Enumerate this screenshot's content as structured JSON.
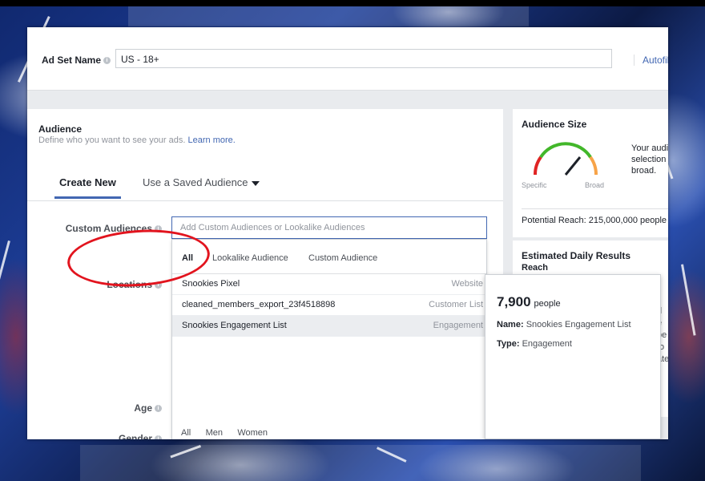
{
  "header": {
    "adset_label": "Ad Set Name",
    "adset_value": "US - 18+",
    "autofill_label": "Autofil"
  },
  "audience": {
    "title": "Audience",
    "subtitle": "Define who you want to see your ads.",
    "learn_more": "Learn more.",
    "tabs": {
      "create_new": "Create New",
      "saved": "Use a Saved Audience"
    },
    "labels": {
      "custom_audiences": "Custom Audiences",
      "locations": "Locations",
      "age": "Age",
      "gender": "Gender"
    },
    "custom_input_placeholder": "Add Custom Audiences or Lookalike Audiences",
    "dropdown": {
      "tabs": [
        "All",
        "Lookalike Audience",
        "Custom Audience"
      ],
      "items": [
        {
          "name": "Snookies Pixel",
          "type": "Website"
        },
        {
          "name": "cleaned_members_export_23f4518898",
          "type": "Customer List"
        },
        {
          "name": "Snookies Engagement List",
          "type": "Engagement"
        }
      ]
    },
    "gender_options": [
      "All",
      "Men",
      "Women"
    ]
  },
  "audience_size": {
    "title": "Audience Size",
    "specific": "Specific",
    "broad": "Broad",
    "text": "Your audi selection broad.",
    "potential_reach": "Potential Reach: 215,000,000 people"
  },
  "estimated": {
    "title": "Estimated Daily Results",
    "reach_label": "Reach",
    "fragments": [
      "d",
      "e",
      "be",
      "fo",
      "ate"
    ]
  },
  "popover": {
    "count": "7,900",
    "unit": "people",
    "name_label": "Name:",
    "name_value": "Snookies Engagement List",
    "type_label": "Type:",
    "type_value": "Engagement"
  },
  "colors": {
    "accent": "#4267b2",
    "annotation": "#e2141e",
    "gauge_red": "#e02424",
    "gauge_green": "#42b72a",
    "gauge_orange": "#f7a348"
  }
}
